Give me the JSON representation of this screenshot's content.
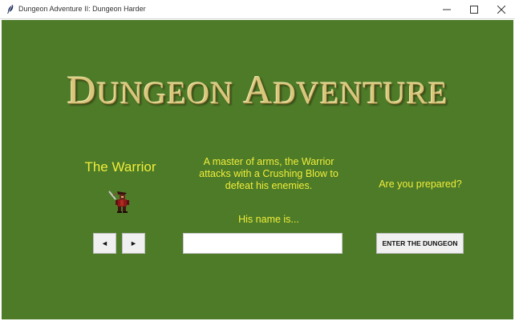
{
  "window": {
    "title": "Dungeon Adventure II: Dungeon Harder",
    "app_icon": "feather-icon",
    "controls": [
      "minimize-icon",
      "maximize-icon",
      "close-icon"
    ]
  },
  "logo": {
    "text": "Dungeon Adventure",
    "word1_cap": "D",
    "word1_rest": "UNGEON",
    "word2_cap": "A",
    "word2_rest": "DVENTURE"
  },
  "character": {
    "class_name": "The Warrior",
    "sprite": "warrior-sprite",
    "description": "A master of arms, the Warrior attacks with a Crushing Blow to defeat his enemies.",
    "name_prompt": "His name is..."
  },
  "prepared_text": "Are you prepared?",
  "controls": {
    "prev_label": "◄",
    "next_label": "►",
    "name_value": "",
    "enter_label": "ENTER THE DUNGEON"
  },
  "colors": {
    "background": "#4d7b28",
    "text": "#f0ed3a",
    "logo": "#d8c77a",
    "button": "#f0f0f0"
  }
}
